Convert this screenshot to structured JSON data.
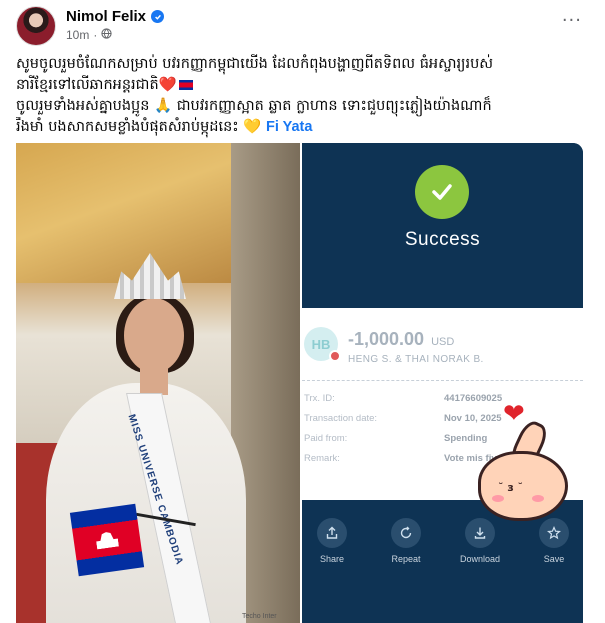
{
  "post": {
    "author": "Nimol Felix",
    "time": "10m",
    "privacy_icon": "globe-icon",
    "more_label": "···",
    "text_lines": [
      "សូមចូលរួមចំណែកសម្រាប់ បវរកញ្ញាកម្ពុជាយើង ដែលកំពុងបង្ហាញពីតទិពល ធំអស្ចារ្យរបស់",
      "នារីខ្មែរទៅលើឆាកអន្តរជាតិ",
      "ចូលរួមទាំងអស់គ្នាបងប្អូន 🙏 ជាបវរកញ្ញាស្អាត ឆ្លាត ក្លាហាន ទោះជួបព្យុះភ្លៀងយ៉ាងណាក៏",
      "រឹងមាំ បងសាកសមខ្លាំងបំផុតសំរាប់ម្កុដនេះ"
    ],
    "mention": "Fi Yata"
  },
  "photo": {
    "sash_text": "MISS UNIVERSE CAMBODIA",
    "watermark": "Techo Inter"
  },
  "receipt": {
    "status": "Success",
    "avatar_initials": "HB",
    "amount": "-1,000.00",
    "currency": "USD",
    "payee": "HENG S. & THAI NORAK B.",
    "rows": [
      {
        "key": "Trx. ID:",
        "value": "44176609025"
      },
      {
        "key": "Transaction date:",
        "value": "Nov 10, 2025"
      },
      {
        "key": "Paid from:",
        "value": "Spending"
      },
      {
        "key": "Remark:",
        "value": "Vote mis fiv"
      }
    ],
    "actions": [
      {
        "label": "Share",
        "icon": "share-icon"
      },
      {
        "label": "Repeat",
        "icon": "repeat-icon"
      },
      {
        "label": "Download",
        "icon": "download-icon"
      },
      {
        "label": "Save",
        "icon": "star-icon"
      }
    ]
  },
  "colors": {
    "mention": "#1877f2",
    "verified": "#1877f2",
    "receipt_bg": "#0e3354",
    "success_check": "#8cc63f"
  }
}
